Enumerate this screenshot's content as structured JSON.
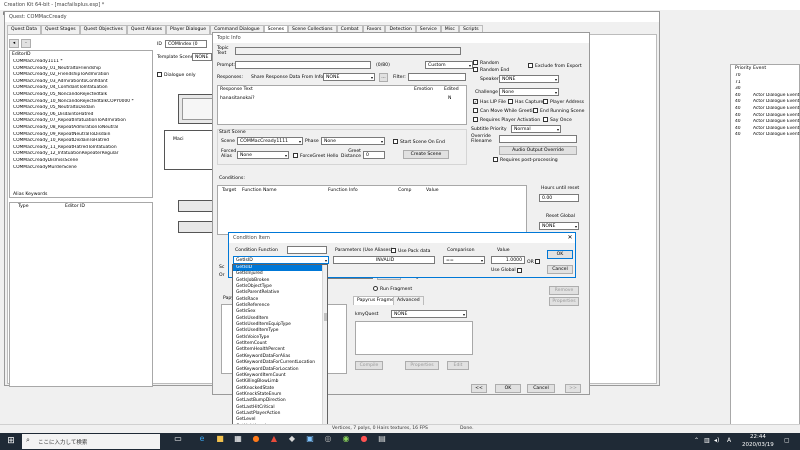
{
  "main_window": {
    "title": "Creation Kit 64-bit - [macfailsplus.esp] *",
    "menu_stub": "Fil"
  },
  "quest_window": {
    "title": "Quest: COMMacCready",
    "tabs": [
      "Quest Data",
      "Quest Stages",
      "Quest Objectives",
      "Quest Aliases",
      "Player Dialogue",
      "Command Dialogue",
      "Scenes",
      "Scene Collections",
      "Combat",
      "Favors",
      "Detection",
      "Service",
      "Misc",
      "Scripts"
    ],
    "active_tab": "Scenes",
    "editor_id_header": "EditorID",
    "scenes": [
      "COMMacCready1111 *",
      "COMMacCready_01_NeutraltoFriendship",
      "COMMacCready_02_FriendshipToAdmiration",
      "COMMacCready_03_AdmirationtoConfidant",
      "COMMacCready_04_ConfidantToInfatuation",
      "COMMacCready_05_NoncandoRejectedtalk",
      "COMMacCready_10_NoncandoRejectedtalkCOPY0000 *",
      "COMMacCready_05_NeutraltoDisdain",
      "COMMacCready_06_DisdaintoHatred",
      "COMMacCready_07_RepeatInfatuationToAdmiration",
      "COMMacCready_08_RepeatAdmirationToNeutral",
      "COMMacCready_09_RepeatNeutralToDisdain",
      "COMMacCready_10_RepeatDisdainToHatred",
      "COMMacCready_11_RepeatHatredToInfatuation",
      "COMMacCready_12_InfatuationRepeaterRegular",
      "COMMacCreadyDismissScene",
      "COMMacCreadyMurderScene"
    ],
    "alias_keywords_label": "Alias Keywords",
    "type_header": "Type",
    "editor_id_col": "Editor ID",
    "id_label": "ID",
    "id_value": "COMIndex (0",
    "template_scene_label": "Template Scene",
    "template_scene_value": "NONE",
    "dialogue_only_label": "Dialogue only",
    "node_label": "Maci"
  },
  "right_panel": {
    "headers": [
      "Priority",
      "Event"
    ],
    "rows": [
      {
        "priority": "70",
        "event": ""
      },
      {
        "priority": "71",
        "event": ""
      },
      {
        "priority": "30",
        "event": ""
      },
      {
        "priority": "40",
        "event": "Actor Dialogue Event"
      },
      {
        "priority": "40",
        "event": "Actor Dialogue Event"
      },
      {
        "priority": "40",
        "event": "Actor Dialogue Event"
      },
      {
        "priority": "40",
        "event": "Actor Dialogue Event"
      },
      {
        "priority": "40",
        "event": "Actor Dialogue Event"
      },
      {
        "priority": "40",
        "event": "Actor Dialogue Event"
      },
      {
        "priority": "40",
        "event": "Actor Dialogue Event"
      }
    ]
  },
  "topic_info": {
    "title": "Topic Info",
    "topic_text_label": "Topic Text",
    "prompt_label": "Prompt:",
    "prompt_counter": "(0/80)",
    "prompt_combo": "Custom",
    "responses_label": "Responses:",
    "share_label": "Share Response Data From Info:",
    "share_value": "NONE",
    "filter_label": "Filter:",
    "response_headers": [
      "Response Text",
      "Emotion",
      "Edited"
    ],
    "response_rows": [
      {
        "text": "hanasitanokai?",
        "emotion": "",
        "edited": "N"
      }
    ],
    "random_label": "Random",
    "random_end_label": "Random End",
    "exclude_export_label": "Exclude from Export",
    "speaker_label": "Speaker",
    "speaker_value": "NONE",
    "challenge_label": "Challenge",
    "challenge_value": "None",
    "has_lip_label": "Has LIP File",
    "has_capture_label": "Has Capture",
    "player_address_label": "Player Address",
    "can_move_label": "Can Move While Greeting",
    "end_running_label": "End Running Scene",
    "requires_player_label": "Requires Player Activation",
    "say_once_label": "Say Once",
    "subtitle_priority_label": "Subtitle Priority",
    "subtitle_priority_value": "Normal",
    "override_filename_label": "Override Filename",
    "audio_output_btn": "Audio Output Override",
    "requires_post_label": "Requires post-processing",
    "start_scene_title": "Start Scene",
    "scene_label": "Scene",
    "scene_value": "COMMacCready1111",
    "phase_label": "Phase",
    "phase_value": "None",
    "start_scene_on_end_label": "Start Scene On End",
    "forced_alias_label": "Forced Alias",
    "forced_alias_value": "None",
    "force_greet_label": "ForceGreet Hello",
    "greet_distance_label": "Greet Distance",
    "greet_distance_value": "0",
    "create_scene_btn": "Create Scene",
    "conditions_label": "Conditions:",
    "condition_headers": [
      "Target",
      "Function Name",
      "Function Info",
      "Comp",
      "Value"
    ],
    "hours_until_reset_label": "Hours until reset",
    "hours_value": "0.00",
    "reset_global_label": "Reset Global",
    "reset_global_value": "NONE",
    "remove_btn": "Remove",
    "properties_btn": "Properties",
    "scripts_tab": "Papyrus",
    "papyrus_fragment_tab": "Papyrus Fragment",
    "advanced_tab": "Advanced",
    "end_label": "On End",
    "run_fragment_label": "Run Fragment",
    "swap_subject_label": "Swap Subject and Target",
    "kmy_quest_label": "kmyQuest",
    "kmy_quest_value": "NONE",
    "compile_btn": "Compile",
    "properties2_btn": "Properties",
    "edit_btn": "Edit",
    "select_btn": "Select",
    "back_btn": "<<",
    "ok_btn": "OK",
    "cancel_btn": "Cancel",
    "fwd_btn": ">>",
    "sc_label": "Sc",
    "or_label": "Or"
  },
  "condition_dialog": {
    "title": "Condition Item",
    "condition_function_label": "Condition Function",
    "function_value": "GetIsID",
    "parameters_label": "Parameters (Use Aliases)",
    "use_pack_label": "Use Pack data",
    "invalid_text": "INVALID",
    "comparison_label": "Comparison",
    "comparison_value": "==",
    "value_label": "Value",
    "value_value": "1.0000",
    "use_global_label": "Use Global",
    "or_label": "OR",
    "ok_btn": "OK",
    "cancel_btn": "Cancel"
  },
  "dropdown_items": [
    "GetIsID",
    "GetIsInjured",
    "GetIsJobBroken",
    "GetIsObjectType",
    "GetIsParentRelative",
    "GetIsRace",
    "GetIsReference",
    "GetIsSex",
    "GetIsUsedItem",
    "GetIsUsedItemEquipType",
    "GetIsUsedItemType",
    "GetIsVoiceType",
    "GetItemCount",
    "GetItemHealthPercent",
    "GetKeywordDataForAlias",
    "GetKeywordDataForCurrentLocation",
    "GetKeywordDataForLocation",
    "GetKeywordItemCount",
    "GetKillingBlowLimb",
    "GetKnockedState",
    "GetKnockStateEnum",
    "GetLastBumpDirection",
    "GetLastHitCritical",
    "GetLastPlayerAction",
    "GetLevel",
    "GetLightLevel",
    "GetLineOfSight",
    "GetLocAliasRefTypeAliveCount",
    "GetLocationAliasCleared",
    "GetLocAliasRefTypeAliveCount"
  ],
  "status_bar": {
    "render_info": "Vertices, 7 polys, 0 Hairs textures, 16 FPS",
    "done": "Done."
  },
  "taskbar": {
    "search_placeholder": "ここに入力して検索",
    "time": "22:44",
    "date": "2020/03/19",
    "ime": "A"
  }
}
